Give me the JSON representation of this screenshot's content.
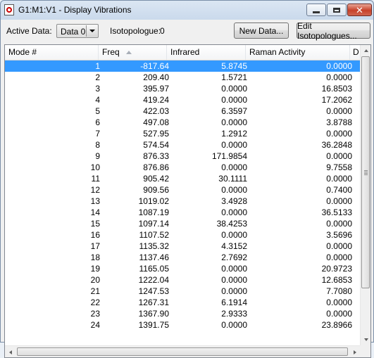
{
  "window": {
    "title": "G1:M1:V1 - Display Vibrations",
    "minimize_icon": "minimize-icon",
    "maximize_icon": "maximize-icon",
    "close_icon": "close-icon",
    "close_glyph": "✕"
  },
  "toolbar": {
    "active_data_label": "Active Data:",
    "active_data_value": "Data 0",
    "isotopologue_label": "Isotopologue:",
    "isotopologue_value": "0",
    "new_data_label": "New Data...",
    "edit_isotopologues_label": "Edit Isotopologues..."
  },
  "table": {
    "columns": [
      "Mode #",
      "Freq",
      "Infrared",
      "Raman Activity",
      "D"
    ],
    "sorted_column": "Freq",
    "selected_row": 0,
    "selection_color": "#3399ff",
    "rows": [
      [
        "1",
        "-817.64",
        "5.8745",
        "0.0000"
      ],
      [
        "2",
        "209.40",
        "1.5721",
        "0.0000"
      ],
      [
        "3",
        "395.97",
        "0.0000",
        "16.8503"
      ],
      [
        "4",
        "419.24",
        "0.0000",
        "17.2062"
      ],
      [
        "5",
        "422.03",
        "6.3597",
        "0.0000"
      ],
      [
        "6",
        "497.08",
        "0.0000",
        "3.8788"
      ],
      [
        "7",
        "527.95",
        "1.2912",
        "0.0000"
      ],
      [
        "8",
        "574.54",
        "0.0000",
        "36.2848"
      ],
      [
        "9",
        "876.33",
        "171.9854",
        "0.0000"
      ],
      [
        "10",
        "876.86",
        "0.0000",
        "9.7558"
      ],
      [
        "11",
        "905.42",
        "30.1111",
        "0.0000"
      ],
      [
        "12",
        "909.56",
        "0.0000",
        "0.7400"
      ],
      [
        "13",
        "1019.02",
        "3.4928",
        "0.0000"
      ],
      [
        "14",
        "1087.19",
        "0.0000",
        "36.5133"
      ],
      [
        "15",
        "1097.14",
        "38.4253",
        "0.0000"
      ],
      [
        "16",
        "1107.52",
        "0.0000",
        "3.5696"
      ],
      [
        "17",
        "1135.32",
        "4.3152",
        "0.0000"
      ],
      [
        "18",
        "1137.46",
        "2.7692",
        "0.0000"
      ],
      [
        "19",
        "1165.05",
        "0.0000",
        "20.9723"
      ],
      [
        "20",
        "1222.04",
        "0.0000",
        "12.6853"
      ],
      [
        "21",
        "1247.53",
        "0.0000",
        "7.7080"
      ],
      [
        "22",
        "1267.31",
        "6.1914",
        "0.0000"
      ],
      [
        "23",
        "1367.90",
        "2.9333",
        "0.0000"
      ],
      [
        "24",
        "1391.75",
        "0.0000",
        "23.8966"
      ]
    ]
  }
}
